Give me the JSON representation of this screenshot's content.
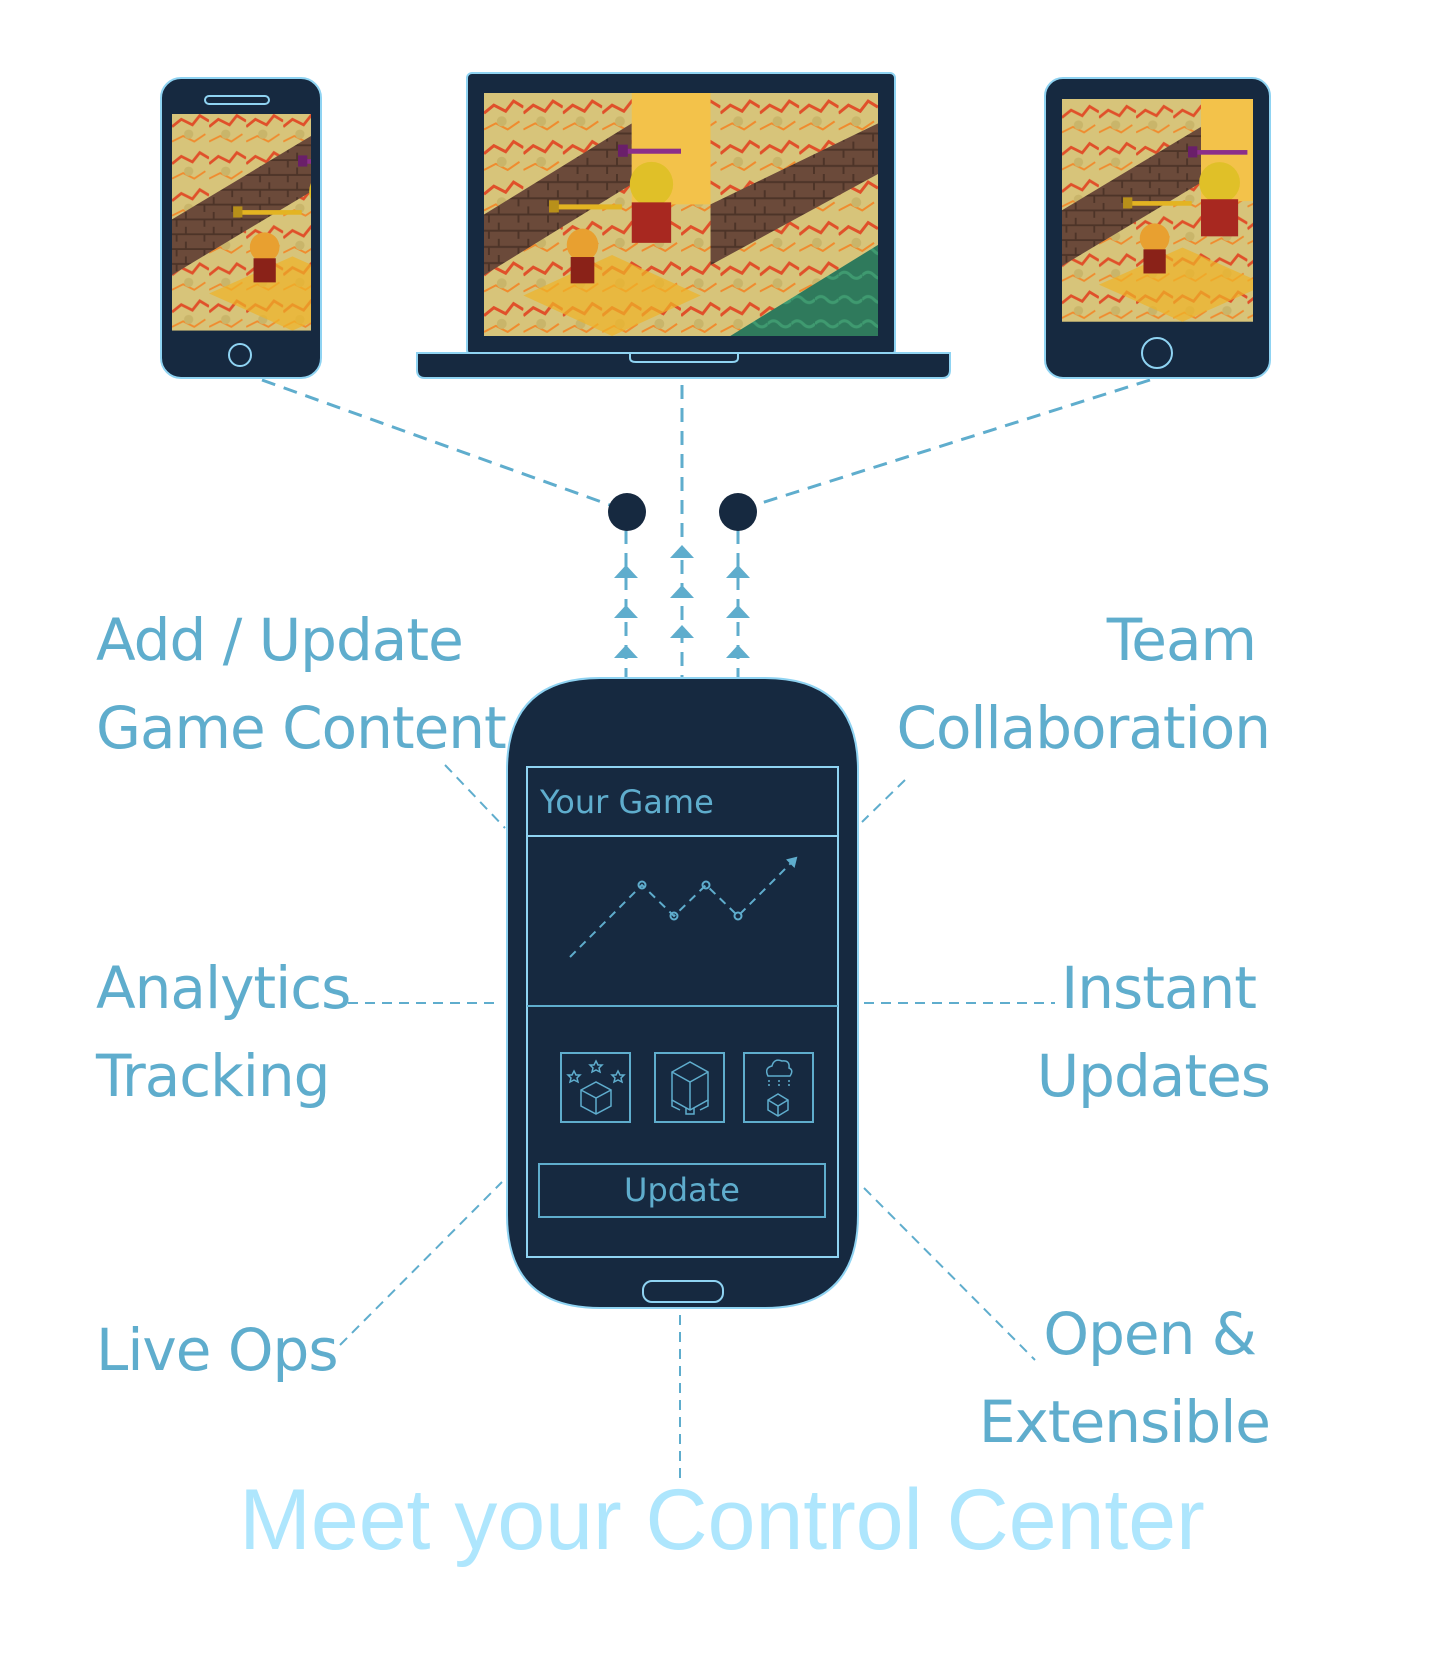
{
  "colors": {
    "navy": "#162940",
    "accent": "#5fadcd",
    "outline": "#8fd3f2",
    "headline": "#aee6fd",
    "background": "#ffffff"
  },
  "devices": {
    "phone": {
      "label": "Smartphone",
      "screen": "game-screenshot"
    },
    "laptop": {
      "label": "Laptop",
      "screen": "game-screenshot"
    },
    "tablet": {
      "label": "Tablet",
      "screen": "game-screenshot"
    }
  },
  "features": {
    "add_update": {
      "line1": "Add / Update",
      "line2": "Game Content"
    },
    "team": {
      "line1": "Team",
      "line2": "Collaboration"
    },
    "analytics": {
      "line1": "Analytics",
      "line2": "Tracking"
    },
    "instant": {
      "line1": "Instant",
      "line2": "Updates"
    },
    "live_ops": {
      "line1": "Live Ops"
    },
    "open": {
      "line1": "Open &",
      "line2": "Extensible"
    }
  },
  "control_phone": {
    "screen_title": "Your Game",
    "chart_icon": "trend-line-icon",
    "tiles": [
      {
        "icon": "cube-stars-icon"
      },
      {
        "icon": "cube-modules-icon"
      },
      {
        "icon": "cloud-sync-cube-icon"
      }
    ],
    "update_button": "Update"
  },
  "headline": "Meet your Control Center"
}
